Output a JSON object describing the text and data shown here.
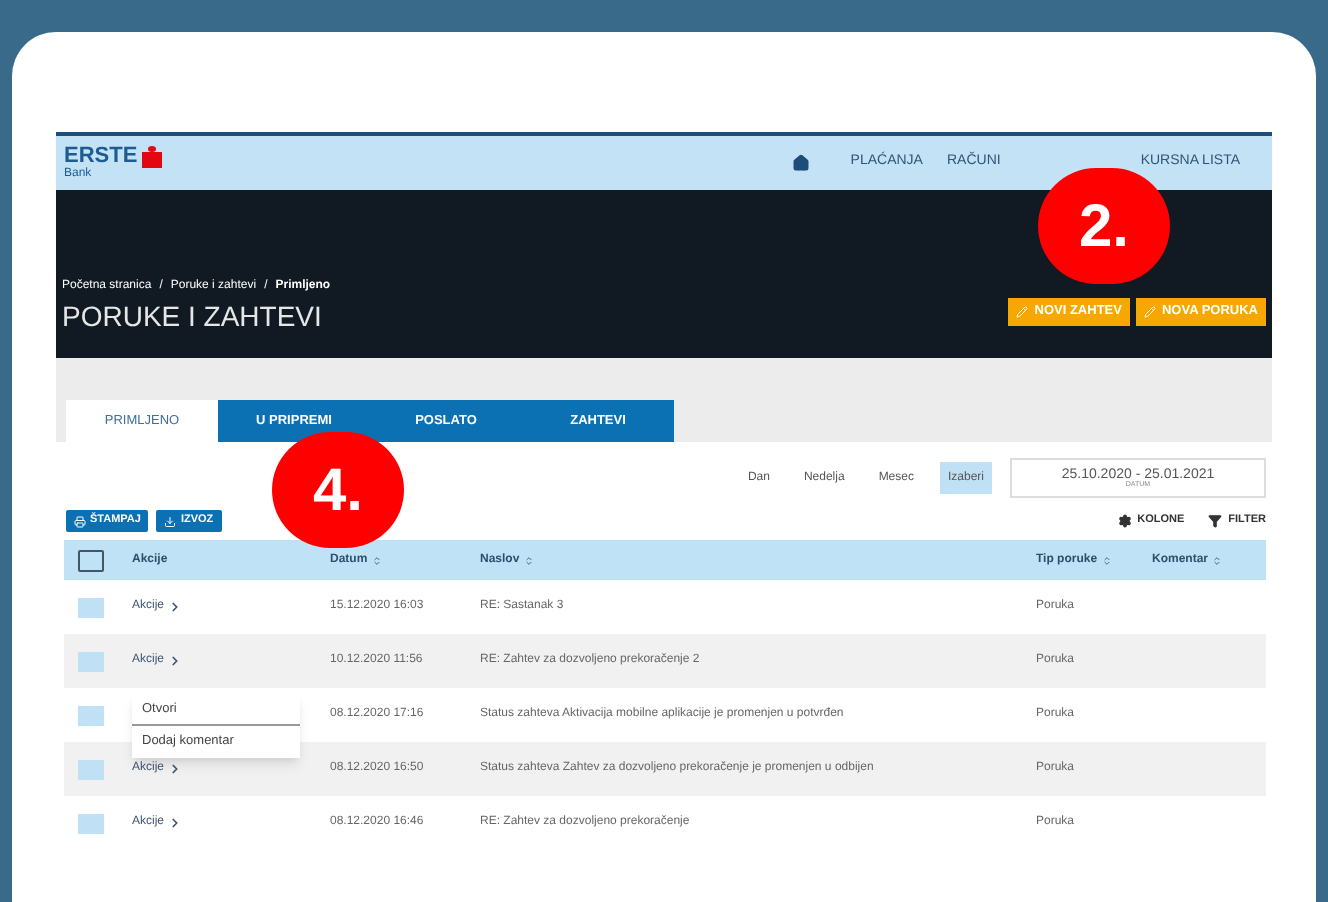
{
  "header": {
    "logo": "ERSTE",
    "logo_sub": "Bank",
    "nav": [
      {
        "kind": "icon"
      },
      {
        "kind": "text",
        "label": "PLAĆANJA"
      },
      {
        "kind": "text",
        "label": "RAČUNI"
      },
      {
        "kind": "text",
        "label": "KURSNA LISTA"
      }
    ]
  },
  "banner": {
    "breadcrumbs": [
      {
        "label": "Početna stranica",
        "current": false
      },
      {
        "label": "Poruke i zahtevi",
        "current": false
      },
      {
        "label": "Primljeno",
        "current": true
      }
    ],
    "separator": "/",
    "title": "PORUKE I ZAHTEVI",
    "buttons": [
      "NOVI ZAHTEV",
      "NOVA PORUKA"
    ]
  },
  "tabs": [
    {
      "label": "PRIMLJENO",
      "selected": true
    },
    {
      "label": "U PRIPREMI",
      "selected": false
    },
    {
      "label": "POSLATO",
      "selected": false
    },
    {
      "label": "ZAHTEVI",
      "selected": false
    }
  ],
  "periods": [
    {
      "label": "Dan",
      "selected": false
    },
    {
      "label": "Nedelja",
      "selected": false
    },
    {
      "label": "Mesec",
      "selected": false
    },
    {
      "label": "Izaberi",
      "selected": true
    }
  ],
  "date_range": {
    "value": "25.10.2020 - 25.01.2021",
    "label": "DATUM"
  },
  "actions": [
    "ŠTAMPAJ",
    "IZVOZ"
  ],
  "tools": [
    "KOLONE",
    "FILTER"
  ],
  "table": {
    "select_all": {
      "checked": false
    },
    "columns": [
      {
        "label": "Akcije",
        "sortable": false
      },
      {
        "label": "Datum",
        "sortable": true
      },
      {
        "label": "Naslov",
        "sortable": true
      },
      {
        "label": "Tip poruke",
        "sortable": true
      },
      {
        "label": "Komentar",
        "sortable": true
      }
    ],
    "rows": [
      {
        "checked": false,
        "action": "Akcije",
        "date": "15.12.2020 16:03",
        "title": "RE: Sastanak 3",
        "type": "Poruka"
      },
      {
        "checked": false,
        "action": "Akcije",
        "date": "10.12.2020 11:56",
        "title": "RE: Zahtev za dozvoljeno prekoračenje 2",
        "type": "Poruka"
      },
      {
        "checked": false,
        "date": "08.12.2020 17:16",
        "title": "Status zahteva Aktivacija mobilne aplikacije je promenjen u potvrđen",
        "type": "Poruka"
      },
      {
        "checked": false,
        "action": "Akcije",
        "date": "08.12.2020 16:50",
        "title": "Status zahteva Zahtev za dozvoljeno prekoračenje je promenjen u odbijen",
        "type": "Poruka"
      },
      {
        "checked": false,
        "action": "Akcije",
        "date": "08.12.2020 16:46",
        "title": "RE: Zahtev za dozvoljeno prekoračenje",
        "type": "Poruka"
      }
    ]
  },
  "row_menu": {
    "items": [
      "Otvori",
      "Dodaj komentar"
    ]
  },
  "annotations": [
    "2.",
    "4."
  ]
}
